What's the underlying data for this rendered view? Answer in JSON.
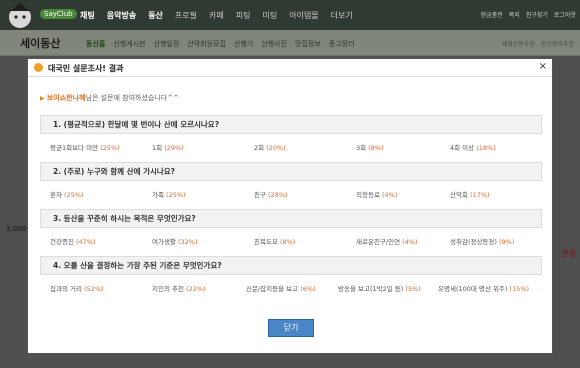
{
  "top": {
    "logo_text": "SayClub",
    "nav": [
      "채팅",
      "음악방송",
      "동산",
      "프로필",
      "카페",
      "피팅",
      "미팅",
      "아이템몰",
      "더보기"
    ],
    "right": [
      "현금충전",
      "쪽지",
      "친구찾기",
      "로그아웃"
    ]
  },
  "sub": {
    "title": "세이동산",
    "nav": [
      "동산홈",
      "산행게시판",
      "산행일정",
      "산악회원모집",
      "산행기",
      "산행사진",
      "맛집정보",
      "중고장터"
    ],
    "right": [
      "배경산동추천",
      "등산장비추천"
    ]
  },
  "peek": {
    "left": "3,000원",
    "right": "관광"
  },
  "modal": {
    "title": "대국민 설문조사! 결과",
    "close_icon": "×",
    "thanks_nick": "보이쇼한나혜",
    "thanks_rest": "님은 설문에 참여하셨습니다^^",
    "close_button": "닫기"
  },
  "questions": [
    {
      "q": "1. (평균적으로) 한달에 몇 번이나 산에 오르시나요?",
      "options": [
        {
          "label": "평균1회보다 미만",
          "pct": "(25%)"
        },
        {
          "label": "1회",
          "pct": "(29%)"
        },
        {
          "label": "2회",
          "pct": "(20%)"
        },
        {
          "label": "3회",
          "pct": "(8%)"
        },
        {
          "label": "4회 이상",
          "pct": "(18%)"
        }
      ]
    },
    {
      "q": "2. (주로) 누구와 함께 산에 가시나요?",
      "options": [
        {
          "label": "혼자",
          "pct": "(25%)"
        },
        {
          "label": "가족",
          "pct": "(25%)"
        },
        {
          "label": "친구",
          "pct": "(28%)"
        },
        {
          "label": "직장동료",
          "pct": "(4%)"
        },
        {
          "label": "산악회",
          "pct": "(17%)"
        }
      ]
    },
    {
      "q": "3. 등산을 꾸준히 하시는 목적은 무엇인가요?",
      "options": [
        {
          "label": "건강증진",
          "pct": "(47%)"
        },
        {
          "label": "여가생활",
          "pct": "(32%)"
        },
        {
          "label": "친목도모",
          "pct": "(8%)"
        },
        {
          "label": "새로운친구/인연",
          "pct": "(4%)"
        },
        {
          "label": "성취감(정상등정)",
          "pct": "(9%)"
        }
      ]
    },
    {
      "q": "4. 오를 산을 결정하는 가장 주된 기준은 무엇인가요?",
      "options": [
        {
          "label": "집과의 거리",
          "pct": "(52%)"
        },
        {
          "label": "지인의 추천",
          "pct": "(22%)"
        },
        {
          "label": "신문/잡지등을 보고",
          "pct": "(6%)"
        },
        {
          "label": "방송을 보고(1박2일 등)",
          "pct": "(5%)"
        },
        {
          "label": "유명세(100대 명산 위주)",
          "pct": "(15%)"
        }
      ]
    }
  ]
}
